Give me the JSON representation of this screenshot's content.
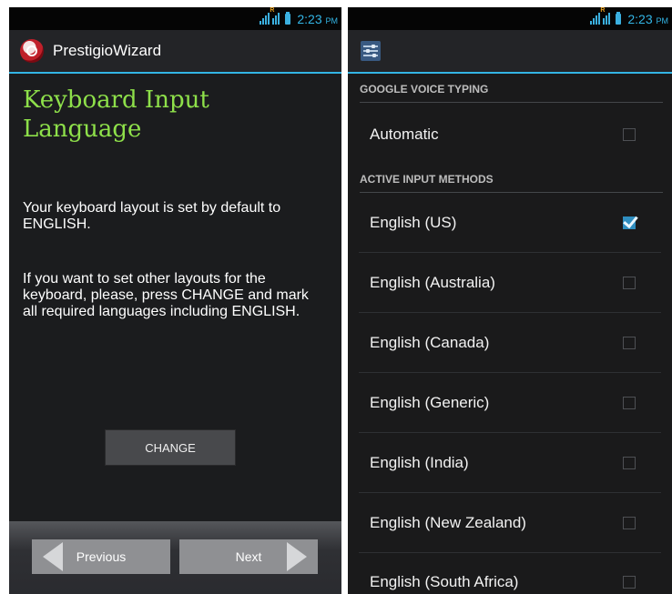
{
  "status": {
    "time": "2:23",
    "ampm": "PM"
  },
  "left": {
    "app_title": "PrestigioWizard",
    "heading": "Keyboard Input Language",
    "para1": "Your keyboard layout is set by default to ENGLISH.",
    "para2": "If you want to set other layouts for the keyboard, please, press CHANGE and mark all required languages including ENGLISH.",
    "change_label": "CHANGE",
    "previous_label": "Previous",
    "next_label": "Next"
  },
  "right": {
    "section1": "GOOGLE VOICE TYPING",
    "section2": "ACTIVE INPUT METHODS",
    "automatic": {
      "label": "Automatic",
      "checked": false
    },
    "methods": [
      {
        "label": "English (US)",
        "checked": true
      },
      {
        "label": "English (Australia)",
        "checked": false
      },
      {
        "label": "English (Canada)",
        "checked": false
      },
      {
        "label": "English (Generic)",
        "checked": false
      },
      {
        "label": "English (India)",
        "checked": false
      },
      {
        "label": "English (New Zealand)",
        "checked": false
      },
      {
        "label": "English (South Africa)",
        "checked": false
      }
    ]
  },
  "colors": {
    "accent": "#33b5e5",
    "heading": "#8ee04a",
    "checkbox_on": "#2f8ec0"
  },
  "icons": {
    "left_app": "prestigio-logo-icon",
    "right_app": "input-settings-icon",
    "checkbox": "checkbox-icon"
  }
}
